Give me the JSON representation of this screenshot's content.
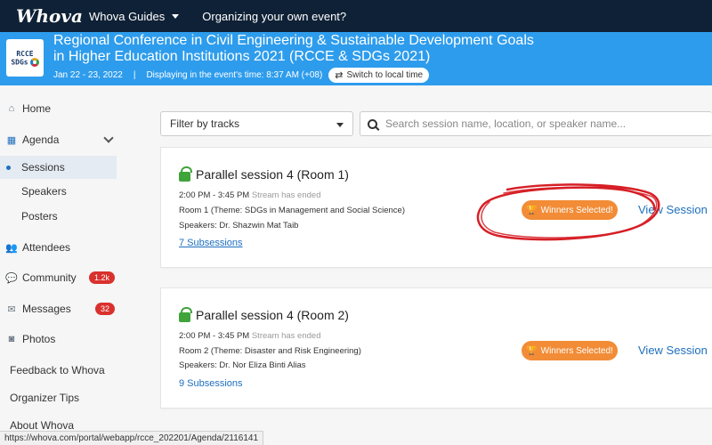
{
  "topbar": {
    "logo": "Whova",
    "guides_label": "Whova Guides",
    "organizing_label": "Organizing your own event?"
  },
  "event": {
    "logo_line1": "RCCE",
    "logo_line2": "SDGs",
    "title_line1": "Regional Conference in Civil Engineering & Sustainable Development Goals",
    "title_line2": "in Higher Education Institutions 2021 (RCCE & SDGs 2021)",
    "dates": "Jan 22 - 23, 2022",
    "separator": "|",
    "display_time": "Displaying in the event's time: 8:37 AM (+08)",
    "switch_label": "Switch to local time"
  },
  "sidebar": {
    "home": "Home",
    "agenda": "Agenda",
    "sessions": "Sessions",
    "speakers": "Speakers",
    "posters": "Posters",
    "attendees": "Attendees",
    "community": "Community",
    "community_badge": "1.2k",
    "messages": "Messages",
    "messages_badge": "32",
    "photos": "Photos",
    "feedback": "Feedback to Whova",
    "organizer_tips": "Organizer Tips",
    "about": "About Whova"
  },
  "filters": {
    "tracks_label": "Filter by tracks",
    "search_placeholder": "Search session name, location, or speaker name..."
  },
  "sessions": [
    {
      "title": "Parallel session 4 (Room 1)",
      "time": "2:00 PM - 3:45 PM",
      "stream_status": "Stream has ended",
      "room": "Room 1 (Theme: SDGs in Management and Social Science)",
      "speakers": "Speakers: Dr. Shazwin Mat Taib",
      "subsessions": "7 Subsessions",
      "winners_label": "Winners Selected!",
      "view_label": "View Session"
    },
    {
      "title": "Parallel session 4 (Room 2)",
      "time": "2:00 PM - 3:45 PM",
      "stream_status": "Stream has ended",
      "room": "Room 2 (Theme: Disaster and Risk Engineering)",
      "speakers": "Speakers: Dr. Nor Eliza Binti Alias",
      "subsessions": "9 Subsessions",
      "winners_label": "Winners Selected!",
      "view_label": "View Session"
    }
  ],
  "status_url": "https://whova.com/portal/webapp/rcce_202201/Agenda/2116141",
  "colors": {
    "topbar": "#0f2136",
    "header": "#2e9cec",
    "accent_link": "#1e6fbe",
    "winners": "#f28c36",
    "badge": "#d9312d",
    "annotation": "#d61f26"
  }
}
